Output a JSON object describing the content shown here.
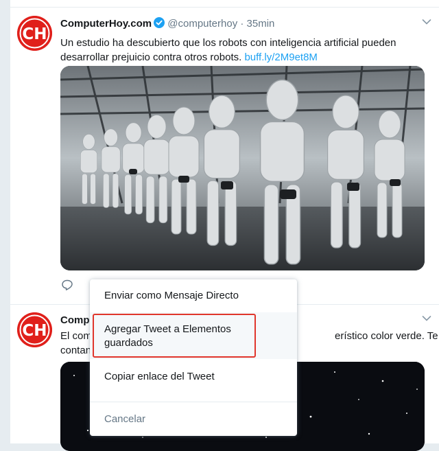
{
  "colors": {
    "brand_red": "#e0201b",
    "link": "#1da1f2",
    "verified": "#1da1f2",
    "muted": "#657786",
    "highlight_box": "#e0352b"
  },
  "tweets": [
    {
      "avatar_text": "CH",
      "name": "ComputerHoy.com",
      "handle": "@computerhoy",
      "separator": "·",
      "time": "35min",
      "text": "Un estudio ha descubierto que los robots con inteligencia artificial pueden desarrollar prejuicio contra otros robots.",
      "link": "buff.ly/2M9et8M",
      "media_icon": "robots-photo",
      "actions": {
        "reply_icon": "reply-icon"
      }
    },
    {
      "avatar_text": "CH",
      "name_visible": "Compu",
      "text_line1_visible": "El com",
      "text_line1_right": "erístico color verde. Te",
      "text_line2_visible": "contan",
      "media_icon": "starfield-photo"
    }
  ],
  "context_menu": {
    "items": [
      {
        "label": "Enviar como Mensaje Directo"
      },
      {
        "label": "Agregar Tweet a Elementos guardados"
      },
      {
        "label": "Copiar enlace del Tweet"
      },
      {
        "label": "Cancelar"
      }
    ]
  }
}
